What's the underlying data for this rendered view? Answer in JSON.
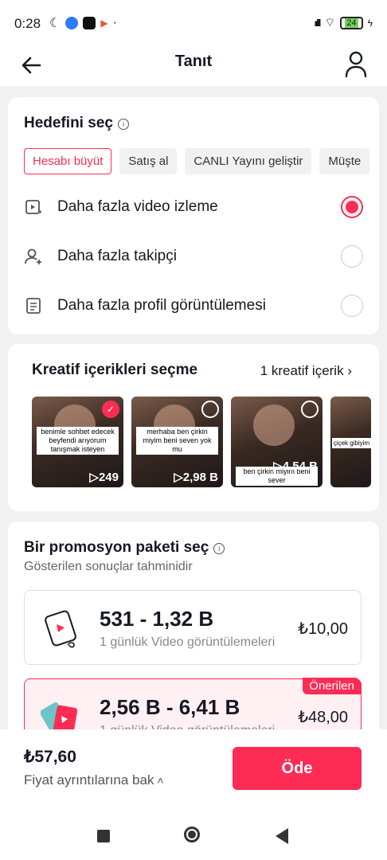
{
  "status": {
    "time": "0:28",
    "battery": "24"
  },
  "header": {
    "title": "Tanıt"
  },
  "goal": {
    "heading": "Hedefini seç",
    "chips": [
      "Hesabı büyüt",
      "Satış al",
      "CANLI Yayını geliştir",
      "Müşte"
    ],
    "options": [
      {
        "label": "Daha fazla video izleme",
        "selected": true,
        "icon": "video-play-icon"
      },
      {
        "label": "Daha fazla takipçi",
        "selected": false,
        "icon": "add-user-icon"
      },
      {
        "label": "Daha fazla profil görüntülemesi",
        "selected": false,
        "icon": "document-icon"
      }
    ]
  },
  "creative": {
    "heading": "Kreatif içerikleri seçme",
    "count_link": "1 kreatif içerik",
    "thumbs": [
      {
        "caption": "benimle sohbet edecek beyfendi arıyorum tanışmak isteyen",
        "views": "249",
        "selected": true
      },
      {
        "caption": "merhaba ben çirkin miyim beni seven yok mu",
        "views": "2,98 B",
        "selected": false
      },
      {
        "caption": "ben çirkin miyim beni sever",
        "views": "4,54 B",
        "selected": false
      },
      {
        "caption": "çiçek gibiyim",
        "views": "",
        "selected": false
      }
    ]
  },
  "package": {
    "heading": "Bir promosyon paketi seç",
    "subtitle": "Gösterilen sonuçlar tahminidir",
    "options": [
      {
        "range": "531 - 1,32 B",
        "desc": "1 günlük Video görüntülemeleri",
        "price": "₺10,00"
      },
      {
        "range": "2,56 B - 6,41 B",
        "desc": "1 günlük Video görüntülemeleri",
        "price": "₺48,00",
        "badge": "Önerilen"
      }
    ]
  },
  "footer": {
    "total": "₺57,60",
    "details_link": "Fiyat ayrıntılarına bak",
    "pay_label": "Öde"
  },
  "colors": {
    "accent": "#fe2c55"
  }
}
